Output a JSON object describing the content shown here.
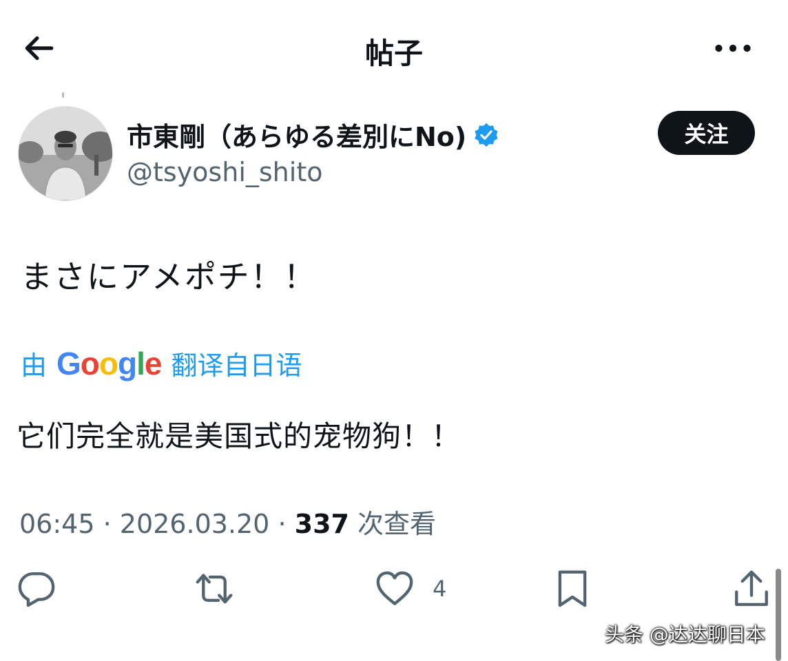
{
  "header": {
    "title": "帖子",
    "back_icon": "arrow-left-icon",
    "more_icon": "more-dots-icon"
  },
  "author": {
    "name": "市東剛（あらゆる差別にNo)",
    "handle": "@tsyoshi_shito",
    "verified_icon": "verified-badge-icon",
    "verified_color": "#1d9bf0",
    "follow_label": "关注"
  },
  "post": {
    "text": "まさにアメポチ！！",
    "translate_prefix": "由",
    "translate_brand": "Google",
    "translate_suffix": "翻译自日语",
    "translated_text": "它们完全就是美国式的宠物狗！！"
  },
  "meta": {
    "time": "06:45",
    "date": "2026.03.20",
    "views_count": "337",
    "views_label": "次查看"
  },
  "actions": {
    "reply_icon": "reply-icon",
    "retweet_icon": "retweet-icon",
    "like_icon": "heart-icon",
    "like_count": "4",
    "bookmark_icon": "bookmark-icon",
    "share_icon": "share-icon"
  },
  "watermark": "头条 @达达聊日本",
  "colors": {
    "accent": "#1d9bf0",
    "text": "#0f1419",
    "secondary": "#536471"
  }
}
